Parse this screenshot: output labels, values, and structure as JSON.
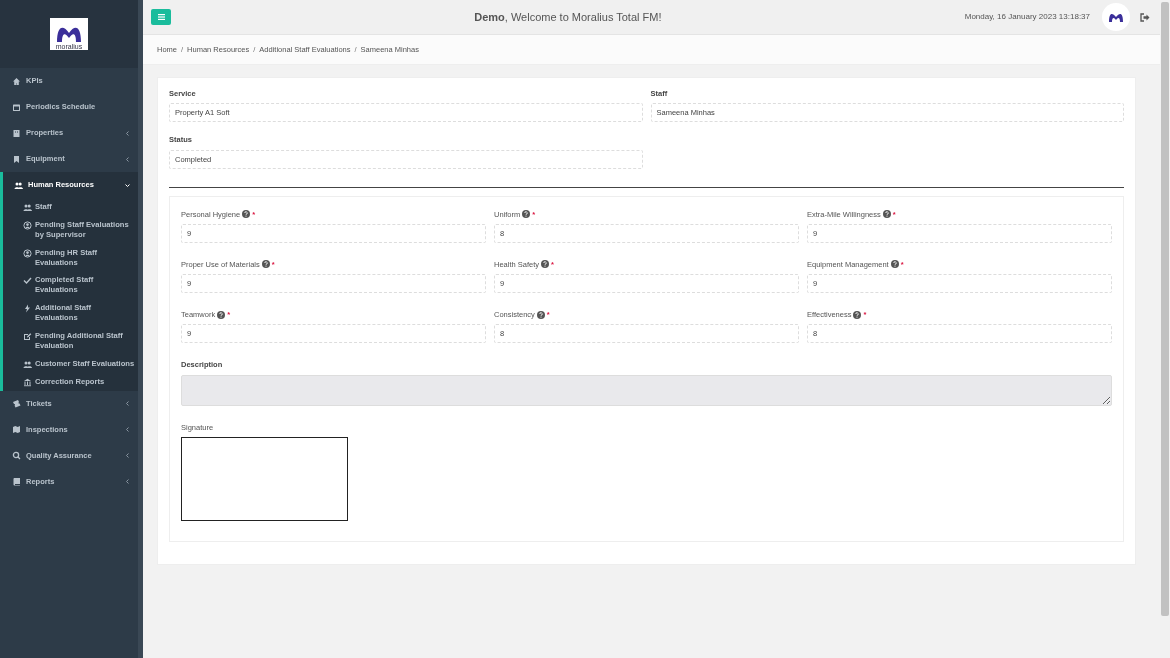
{
  "sidebar": {
    "logo_text": "moralius",
    "items": [
      {
        "label": "KPIs",
        "has_submenu": false,
        "expanded": false
      },
      {
        "label": "Periodics Schedule",
        "has_submenu": false,
        "expanded": false
      },
      {
        "label": "Properties",
        "has_submenu": true,
        "expanded": false
      },
      {
        "label": "Equipment",
        "has_submenu": true,
        "expanded": false
      },
      {
        "label": "Human Resources",
        "has_submenu": true,
        "expanded": true,
        "children": [
          {
            "label": "Staff"
          },
          {
            "label": "Pending Staff Evaluations by Supervisor"
          },
          {
            "label": "Pending HR Staff Evaluations"
          },
          {
            "label": "Completed Staff Evaluations"
          },
          {
            "label": "Additional Staff Evaluations"
          },
          {
            "label": "Pending Additional Staff Evaluation"
          },
          {
            "label": "Customer Staff Evaluations"
          },
          {
            "label": "Correction Reports"
          }
        ]
      },
      {
        "label": "Tickets",
        "has_submenu": true,
        "expanded": false
      },
      {
        "label": "Inspections",
        "has_submenu": true,
        "expanded": false
      },
      {
        "label": "Quality Assurance",
        "has_submenu": true,
        "expanded": false
      },
      {
        "label": "Reports",
        "has_submenu": true,
        "expanded": false
      }
    ]
  },
  "topbar": {
    "welcome_name": "Demo",
    "welcome_text": ", Welcome to Moralius Total FM!",
    "datetime": "Monday, 16 January 2023 13:18:37"
  },
  "breadcrumb": {
    "separator": "/",
    "items": [
      "Home",
      "Human Resources",
      "Additional Staff Evaluations",
      "Sameena Minhas"
    ]
  },
  "form": {
    "top_fields": [
      {
        "label": "Service",
        "value": "Property A1 Soft"
      },
      {
        "label": "Staff",
        "value": "Sameena Minhas"
      },
      {
        "label": "Status",
        "value": "Completed"
      }
    ],
    "scores": [
      {
        "label": "Personal Hygiene",
        "required_mark": "*",
        "value": "9"
      },
      {
        "label": "Uniform",
        "required_mark": "*",
        "value": "8"
      },
      {
        "label": "Extra-Mile Willingness",
        "required_mark": "*",
        "value": "9"
      },
      {
        "label": "Proper Use of Materials",
        "required_mark": "*",
        "value": "9"
      },
      {
        "label": "Health Safety",
        "required_mark": "*",
        "value": "9"
      },
      {
        "label": "Equipment Management",
        "required_mark": "*",
        "value": "9"
      },
      {
        "label": "Teamwork",
        "required_mark": "*",
        "value": "9"
      },
      {
        "label": "Consistency",
        "required_mark": "*",
        "value": "8"
      },
      {
        "label": "Effectiveness",
        "required_mark": "*",
        "value": "8"
      }
    ],
    "description_label": "Description",
    "signature_label": "Signature"
  }
}
